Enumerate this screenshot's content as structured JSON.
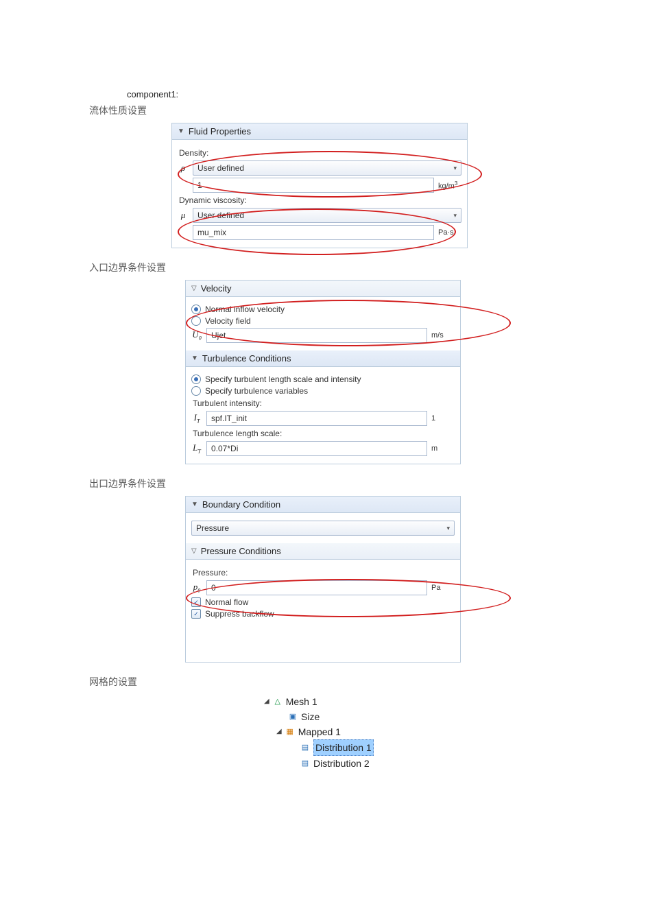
{
  "line_component": "component1:",
  "sections": {
    "fluid_title": "流体性质设置",
    "inlet_title": "入口边界条件设置",
    "outlet_title": "出口边界条件设置",
    "mesh_title": "网格的设置"
  },
  "fluid_props": {
    "header": "Fluid Properties",
    "density_label": "Density:",
    "density_symbol": "ρ",
    "density_select": "User defined",
    "density_value": "1",
    "density_unit_main": "kg/m",
    "density_unit_sup": "3",
    "visc_label": "Dynamic viscosity:",
    "visc_symbol": "μ",
    "visc_select": "User defined",
    "visc_value": "mu_mix",
    "visc_unit": "Pa·s"
  },
  "inlet": {
    "velocity_header": "Velocity",
    "radio_normal": "Normal inflow velocity",
    "radio_field": "Velocity field",
    "u0_symbol_main": "U",
    "u0_symbol_sub": "0",
    "u0_value": "Ujet",
    "u0_unit": "m/s",
    "turb_header": "Turbulence Conditions",
    "radio_spec_ls": "Specify turbulent length scale and intensity",
    "radio_spec_vars": "Specify turbulence variables",
    "ti_label": "Turbulent intensity:",
    "it_symbol_main": "I",
    "it_symbol_sub": "T",
    "it_value": "spf.IT_init",
    "it_unit": "1",
    "lt_label": "Turbulence length scale:",
    "lt_symbol_main": "L",
    "lt_symbol_sub": "T",
    "lt_value": "0.07*Di",
    "lt_unit": "m"
  },
  "outlet": {
    "bc_header": "Boundary Condition",
    "bc_select": "Pressure",
    "pc_header": "Pressure Conditions",
    "p_label": "Pressure:",
    "p_symbol_main": "p",
    "p_symbol_sub": "0",
    "p_value": "0",
    "p_unit": "Pa",
    "normal_flow": "Normal flow",
    "suppress_bf": "Suppress backflow"
  },
  "mesh": {
    "mesh1": "Mesh 1",
    "size": "Size",
    "mapped1": "Mapped 1",
    "dist1": "Distribution 1",
    "dist2": "Distribution 2"
  }
}
